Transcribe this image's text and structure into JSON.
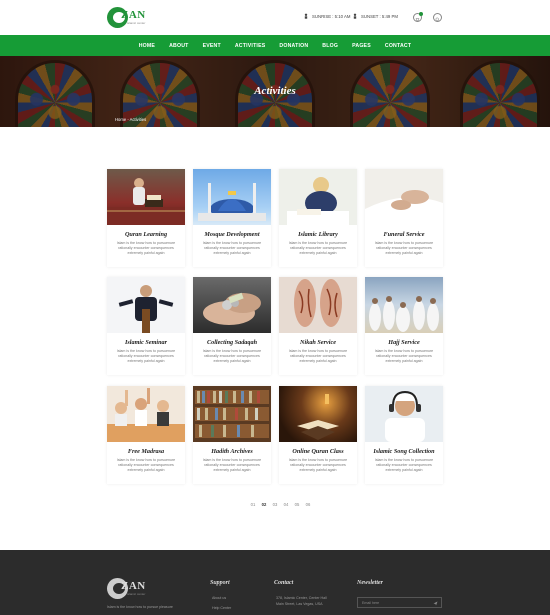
{
  "brand": {
    "name": "ZAN",
    "tagline": "islamic center"
  },
  "header": {
    "sunrise": "SUNRISE : 5:10 AM",
    "sunset": "SUNSET : 5:49 PM"
  },
  "nav": [
    "HOME",
    "ABOUT",
    "EVENT",
    "ACTIVITIES",
    "DONATION",
    "BLOG",
    "PAGES",
    "CONTACT"
  ],
  "banner": {
    "title": "Activities",
    "breadcrumb": "Home - Activities"
  },
  "cards": [
    {
      "title": "Quran Learning",
      "text": "Islam is the know how to pursuenure rationally encounter consequences extremely painful again",
      "image": "child-reading-quran"
    },
    {
      "title": "Mosque Development",
      "text": "Islam is the know how to pursuenure rationally encounter consequences extremely painful again",
      "image": "blue-domed-mosque"
    },
    {
      "title": "Islamic Library",
      "text": "Islam is the know how to pursuenure rationally encounter consequences extremely painful again",
      "image": "girl-studying"
    },
    {
      "title": "Funeral Service",
      "text": "Islam is the know how to pursuenure rationally encounter consequences extremely painful again",
      "image": "feet-on-white-cloth"
    },
    {
      "title": "Islamic Seminar",
      "text": "Islam is the know how to pursuenure rationally encounter consequences extremely painful again",
      "image": "speaker-at-podium"
    },
    {
      "title": "Collecting Sadaqah",
      "text": "Islam is the know how to pursuenure rationally encounter consequences extremely painful again",
      "image": "hands-with-coins"
    },
    {
      "title": "Nikah Service",
      "text": "Islam is the know how to pursuenure rationally encounter consequences extremely painful again",
      "image": "henna-hands"
    },
    {
      "title": "Hajj Service",
      "text": "Islam is the know how to pursuenure rationally encounter consequences extremely painful again",
      "image": "pilgrims-in-white"
    },
    {
      "title": "Free Madrasa",
      "text": "Islam is the know how to pursuenure rationally encounter consequences extremely painful again",
      "image": "children-raising-hands"
    },
    {
      "title": "Hadith Archives",
      "text": "Islam is the know how to pursuenure rationally encounter consequences extremely painful again",
      "image": "bookshelves"
    },
    {
      "title": "Online Quran Class",
      "text": "Islam is the know how to pursuenure rationally encounter consequences extremely painful again",
      "image": "quran-on-stand"
    },
    {
      "title": "Islamic Song Collection",
      "text": "Islam is the know how to pursuenure rationally encounter consequences extremely painful again",
      "image": "man-with-headphones"
    }
  ],
  "pagination": [
    "01",
    "02",
    "03",
    "04",
    "05",
    "06"
  ],
  "footer": {
    "text": "Islam is the know how to pursue pleasure",
    "support_title": "Support",
    "support_links": [
      "About us",
      "Help Center"
    ],
    "contact_title": "Contact",
    "contact_text": [
      "378, Islamic Center, Center Hall",
      "Main Street, Las Vegas, USA"
    ],
    "newsletter_title": "Newsletter",
    "newsletter_placeholder": "Email here"
  },
  "colors": {
    "green": "#169c36",
    "footer": "#2c2c2c"
  }
}
